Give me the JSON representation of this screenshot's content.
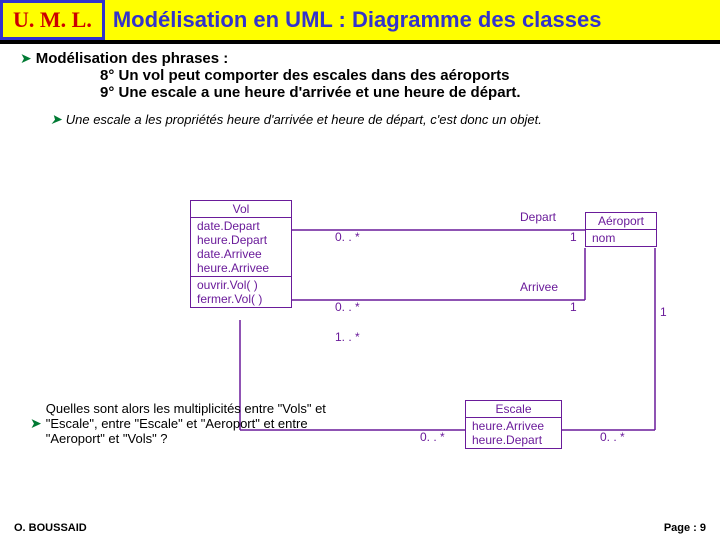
{
  "header": {
    "logo": "U. M. L.",
    "title": "Modélisation en UML : Diagramme des classes"
  },
  "section": {
    "heading": "Modélisation des phrases :",
    "item8": "8° Un vol peut comporter des escales dans des aéroports",
    "item9": "9° Une escale a une heure d'arrivée et une heure de départ.",
    "note": "Une escale a les propriétés heure d'arrivée et heure de départ, c'est donc un objet.",
    "question": "Quelles sont alors les multiplicités entre \"Vols\" et \"Escale\", entre \"Escale\" et \"Aeroport\" et entre \"Aeroport\" et \"Vols\" ?"
  },
  "uml": {
    "vol": {
      "name": "Vol",
      "attrs1": "date.Depart",
      "attrs2": "heure.Depart",
      "attrs3": "date.Arrivee",
      "attrs4": "heure.Arrivee",
      "op1": "ouvrir.Vol( )",
      "op2": "fermer.Vol( )"
    },
    "aeroport": {
      "name": "Aéroport",
      "attr": "nom"
    },
    "escale": {
      "name": "Escale",
      "attr1": "heure.Arrivee",
      "attr2": "heure.Depart"
    },
    "assoc": {
      "depart": "Depart",
      "arrivee": "Arrivee",
      "m0s": "0. . *",
      "m1": "1",
      "m1s": "1. . *"
    }
  },
  "footer": {
    "author": "O. BOUSSAID",
    "page": "Page : 9"
  }
}
